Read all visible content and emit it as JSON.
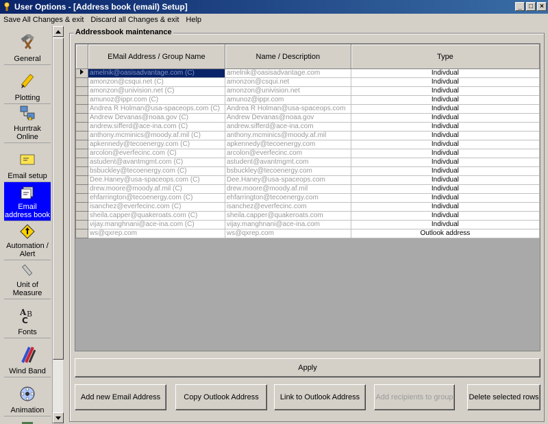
{
  "window": {
    "title": "User Options - [Address book (email) Setup]",
    "controls": [
      "_",
      "□",
      "×"
    ]
  },
  "menu": [
    "Save All Changes & exit",
    "Discard all Changes & exit",
    "Help"
  ],
  "sidebar": {
    "items": [
      {
        "label": "General",
        "icon": "hammer-icon"
      },
      {
        "label": "Plotting",
        "icon": "pencil-icon"
      },
      {
        "label": "Hurrtrak Online",
        "icon": "network-icon"
      },
      {
        "label": "Email setup",
        "icon": "envelope-icon"
      },
      {
        "label": "Email address book",
        "icon": "address-book-icon"
      },
      {
        "label": "Automation / Alert",
        "icon": "alert-sign-icon"
      },
      {
        "label": "Unit of Measure",
        "icon": "ruler-icon"
      },
      {
        "label": "Fonts",
        "icon": "fonts-icon"
      },
      {
        "label": "Wind Band",
        "icon": "wind-band-icon"
      },
      {
        "label": "Animation",
        "icon": "animation-icon"
      }
    ],
    "selected": 4
  },
  "groupbox": {
    "title": "Addressbook maintenance"
  },
  "table": {
    "columns": [
      "EMail Address / Group Name",
      "Name / Description",
      "Type"
    ],
    "rows": [
      [
        "amelnik@oasisadvantage.com (C)",
        "amelnik@oasisadvantage.com",
        "Indivdual"
      ],
      [
        "amonzon@csqui.net (C)",
        "amonzon@csqui.net",
        "Indivdual"
      ],
      [
        "amonzon@univision.net (C)",
        "amonzon@univision.net",
        "Indivdual"
      ],
      [
        "amunoz@ippr.com (C)",
        "amunoz@ippr.com",
        "Indivdual"
      ],
      [
        "Andrea R Holman@usa-spaceops.com (C)",
        "Andrea R Holman@usa-spaceops.com",
        "Indivdual"
      ],
      [
        "Andrew Devanas@noaa.gov (C)",
        "Andrew Devanas@noaa.gov",
        "Indivdual"
      ],
      [
        "andrew.sifferd@ace-ina.com (C)",
        "andrew.sifferd@ace-ina.com",
        "Indivdual"
      ],
      [
        "anthony.mcminics@moody.af.mil (C)",
        "anthony.mcminics@moody.af.mil",
        "Indivdual"
      ],
      [
        "apkennedy@tecoenergy.com (C)",
        "apkennedy@tecoenergy.com",
        "Indivdual"
      ],
      [
        "arcolon@everfecinc.com (C)",
        "arcolon@everfecinc.com",
        "Indivdual"
      ],
      [
        "astudent@avantmgmt.com (C)",
        "astudent@avantmgmt.com",
        "Indivdual"
      ],
      [
        "bsbuckley@tecoenergy.com (C)",
        "bsbuckley@tecoenergy.com",
        "Indivdual"
      ],
      [
        "Dee.Haney@usa-spaceops.com (C)",
        "Dee.Haney@usa-spaceops.com",
        "Indivdual"
      ],
      [
        "drew.moore@moody.af.mil (C)",
        "drew.moore@moody.af.mil",
        "Indivdual"
      ],
      [
        "ehfarrington@tecoenergy.com (C)",
        "ehfarrington@tecoenergy.com",
        "Indivdual"
      ],
      [
        "isanchez@everfecinc.com (C)",
        "isanchez@everfecinc.com",
        "Indivdual"
      ],
      [
        "sheila.capper@quakeroats.com (C)",
        "sheila.capper@quakeroats.com",
        "Indivdual"
      ],
      [
        "vijay.manghnani@ace-ina.com (C)",
        "vijay.manghnani@ace-ina.com",
        "Indivdual"
      ],
      [
        "ws@qxrep.com",
        "ws@qxrep.com",
        "Outlook address"
      ]
    ]
  },
  "buttons": {
    "apply": "Apply",
    "add_email": "Add new Email Address",
    "copy_outlook": "Copy Outlook Address",
    "link_outlook": "Link to Outlook Address",
    "add_recipients": "Add recipients to group",
    "delete_rows": "Delete selected rows"
  }
}
